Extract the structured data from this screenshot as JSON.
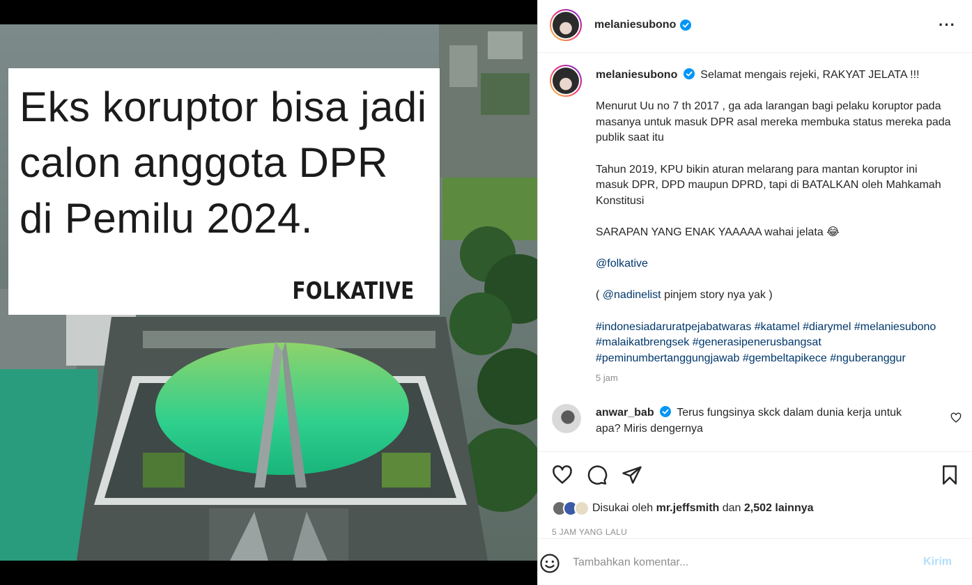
{
  "post_image": {
    "headline": "Eks koruptor bisa jadi calon anggota DPR di Pemilu 2024.",
    "brand": "FOLKATIVE"
  },
  "header": {
    "username": "melaniesubono"
  },
  "caption": {
    "username": "melaniesubono",
    "first_line": "Selamat mengais rejeki, RAKYAT JELATA !!!",
    "paragraph_1": "Menurut Uu no 7 th 2017 , ga ada larangan bagi pelaku koruptor pada masanya untuk masuk DPR asal mereka membuka status mereka pada publik saat itu",
    "paragraph_2": "Tahun 2019, KPU bikin aturan melarang para mantan koruptor ini masuk DPR, DPD maupun DPRD, tapi di BATALKAN oleh Mahkamah Konstitusi",
    "paragraph_3": "SARAPAN YANG ENAK YAAAAA wahai jelata 😂",
    "mention_1": "@folkative",
    "paren_open": "( ",
    "mention_2": "@nadinelist",
    "paren_rest": " pinjem story nya yak )",
    "hashtags": "#indonesiadaruratpejabatwaras #katamel #diarymel #melaniesubono #malaikatbrengsek #generasipenerusbangsat #peminumbertanggungjawab #gembeltapikece #nguberanggur",
    "time": "5 jam"
  },
  "comment": {
    "username": "anwar_bab",
    "text": "Terus fungsinya skck dalam dunia kerja untuk apa? Miris dengernya"
  },
  "likes": {
    "prefix": "Disukai oleh",
    "user": "mr.jeffsmith",
    "middle": "dan",
    "count": "2,502 lainnya"
  },
  "post_time": "5 JAM YANG LALU",
  "add_comment": {
    "placeholder": "Tambahkan komentar...",
    "post_label": "Kirim"
  },
  "colors": {
    "link": "#00376b",
    "verified": "#0095f6",
    "post_disabled": "#b2dffc"
  }
}
